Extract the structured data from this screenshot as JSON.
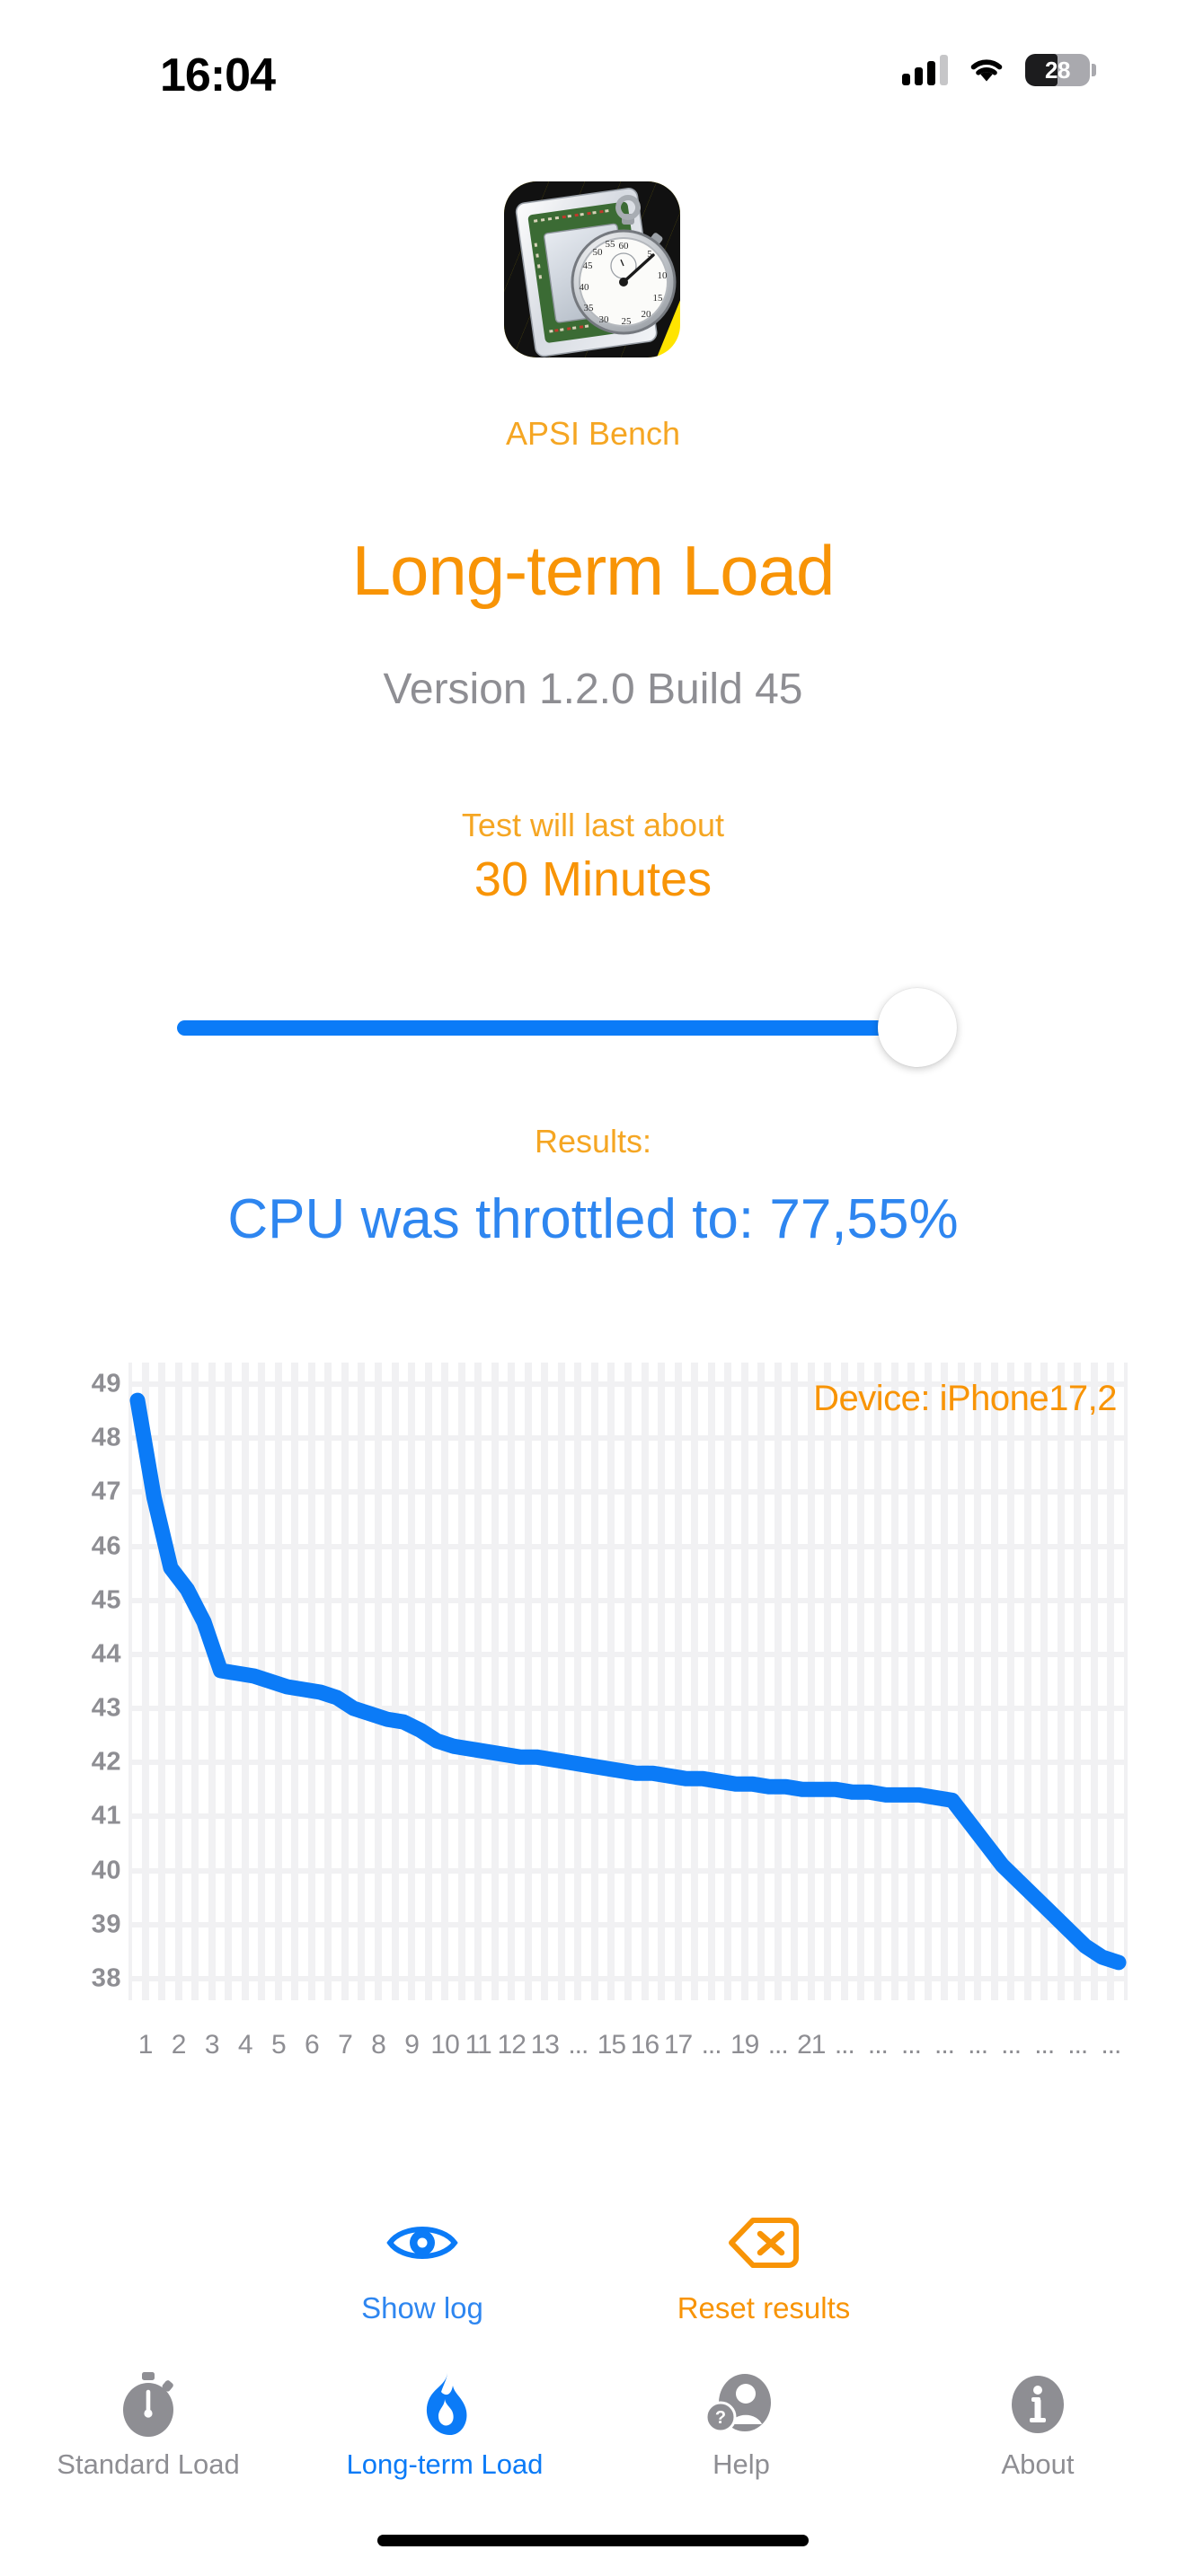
{
  "status_bar": {
    "time": "16:04",
    "cellular_icon": "cellular-signal-icon",
    "cellular_bars_filled": 3,
    "cellular_bars_total": 4,
    "wifi_icon": "wifi-icon",
    "battery_icon": "battery-icon",
    "battery_percent": "28"
  },
  "header": {
    "app_icon": "apsi-bench-app-icon",
    "app_name": "APSI Bench",
    "page_title": "Long-term Load",
    "version": "Version 1.2.0 Build 45",
    "duration_note": "Test will last about",
    "duration_value": "30 Minutes"
  },
  "slider": {
    "name": "duration-slider",
    "value_label": "30 Minutes",
    "fill_percent": 100
  },
  "results": {
    "label": "Results:",
    "value": "CPU was throttled to: 77,55%"
  },
  "chart_data": {
    "type": "line",
    "title": "",
    "annotation": "Device: iPhone17,2",
    "xlabel": "",
    "ylabel": "",
    "ylim": [
      37.6,
      49.4
    ],
    "yticks": [
      49,
      48,
      47,
      46,
      45,
      44,
      43,
      42,
      41,
      40,
      39,
      38
    ],
    "grid": true,
    "legend": "none",
    "line_color": "#0b7bf7",
    "xtick_labels": [
      "1",
      "2",
      "3",
      "4",
      "5",
      "6",
      "7",
      "8",
      "9",
      "10",
      "11",
      "12",
      "13",
      "...",
      "15",
      "16",
      "17",
      "...",
      "19",
      "...",
      "21",
      "...",
      "...",
      "...",
      "...",
      "...",
      "...",
      "...",
      "...",
      "..."
    ],
    "x": [
      1,
      2,
      3,
      4,
      5,
      6,
      7,
      8,
      9,
      10,
      11,
      12,
      13,
      14,
      15,
      16,
      17,
      18,
      19,
      20,
      21,
      22,
      23,
      24,
      25,
      26,
      27,
      28,
      29,
      30,
      31,
      32,
      33,
      34,
      35,
      36,
      37,
      38,
      39,
      40,
      41,
      42,
      43,
      44,
      45,
      46,
      47,
      48,
      49,
      50,
      51,
      52,
      53,
      54,
      55,
      56,
      57,
      58,
      59,
      60
    ],
    "values": [
      48.7,
      46.9,
      45.6,
      45.2,
      44.6,
      43.7,
      43.65,
      43.6,
      43.5,
      43.4,
      43.35,
      43.3,
      43.2,
      43.0,
      42.9,
      42.8,
      42.75,
      42.6,
      42.4,
      42.3,
      42.25,
      42.2,
      42.15,
      42.1,
      42.1,
      42.05,
      42.0,
      41.95,
      41.9,
      41.85,
      41.8,
      41.8,
      41.75,
      41.7,
      41.7,
      41.65,
      41.6,
      41.6,
      41.55,
      41.55,
      41.5,
      41.5,
      41.5,
      41.45,
      41.45,
      41.4,
      41.4,
      41.4,
      41.35,
      41.3,
      40.9,
      40.5,
      40.1,
      39.8,
      39.5,
      39.2,
      38.9,
      38.6,
      38.4,
      38.3
    ]
  },
  "actions": [
    {
      "name": "show-log-button",
      "icon": "eye-icon",
      "label": "Show log",
      "color": "#2e86f0"
    },
    {
      "name": "reset-results-button",
      "icon": "delete-left-x-icon",
      "label": "Reset results",
      "color": "#f89406"
    }
  ],
  "tabs": [
    {
      "name": "tab-standard-load",
      "icon": "stopwatch-icon",
      "label": "Standard Load",
      "active": false
    },
    {
      "name": "tab-long-term-load",
      "icon": "flame-icon",
      "label": "Long-term Load",
      "active": true
    },
    {
      "name": "tab-help",
      "icon": "person-question-icon",
      "label": "Help",
      "active": false
    },
    {
      "name": "tab-about",
      "icon": "info-circle-icon",
      "label": "About",
      "active": false
    }
  ],
  "colors": {
    "accent_orange": "#f89406",
    "accent_blue": "#0b7bf7",
    "text_gray": "#8e8e93"
  }
}
